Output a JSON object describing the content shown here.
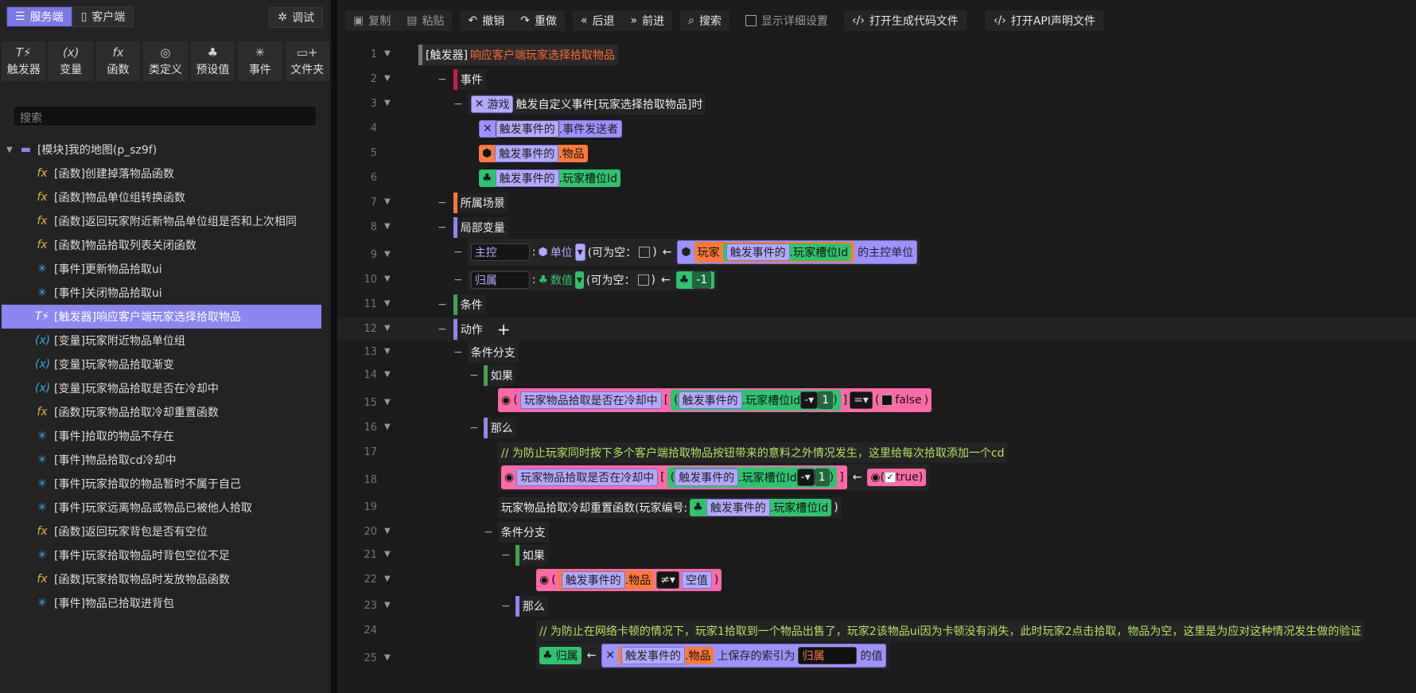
{
  "left_panel": {
    "modes": [
      "服务端",
      "客户端"
    ],
    "debug_label": "调试",
    "categories": [
      {
        "icon": "trigger",
        "label": "触发器"
      },
      {
        "icon": "variable",
        "label": "变量"
      },
      {
        "icon": "fx",
        "label": "函数"
      },
      {
        "icon": "class",
        "label": "类定义"
      },
      {
        "icon": "preset",
        "label": "预设值"
      },
      {
        "icon": "event",
        "label": "事件"
      },
      {
        "icon": "folder",
        "label": "文件夹"
      }
    ],
    "search_placeholder": "搜索",
    "tree_root": "[模块]我的地图(p_sz9f)",
    "tree_items": [
      {
        "type": "fx",
        "label": "[函数]创建掉落物品函数"
      },
      {
        "type": "fx",
        "label": "[函数]物品单位组转换函数"
      },
      {
        "type": "fx",
        "label": "[函数]返回玩家附近新物品单位组是否和上次相同"
      },
      {
        "type": "fx",
        "label": "[函数]物品拾取列表关闭函数"
      },
      {
        "type": "ev",
        "label": "[事件]更新物品拾取ui"
      },
      {
        "type": "ev",
        "label": "[事件]关闭物品拾取ui"
      },
      {
        "type": "tr",
        "label": "[触发器]响应客户端玩家选择拾取物品",
        "selected": true
      },
      {
        "type": "vr",
        "label": "[变量]玩家附近物品单位组"
      },
      {
        "type": "vr",
        "label": "[变量]玩家物品拾取渐变"
      },
      {
        "type": "vr",
        "label": "[变量]玩家物品拾取是否在冷却中"
      },
      {
        "type": "fx",
        "label": "[函数]玩家物品拾取冷却重置函数"
      },
      {
        "type": "ev",
        "label": "[事件]拾取的物品不存在"
      },
      {
        "type": "ev",
        "label": "[事件]物品拾取cd冷却中"
      },
      {
        "type": "ev",
        "label": "[事件]玩家拾取的物品暂时不属于自己"
      },
      {
        "type": "ev",
        "label": "[事件]玩家远离物品或物品已被他人拾取"
      },
      {
        "type": "fx",
        "label": "[函数]返回玩家背包是否有空位"
      },
      {
        "type": "ev",
        "label": "[事件]玩家拾取物品时背包空位不足"
      },
      {
        "type": "fx",
        "label": "[函数]玩家拾取物品时发放物品函数"
      },
      {
        "type": "ev",
        "label": "[事件]物品已拾取进背包"
      }
    ]
  },
  "toolbar": {
    "copy": "复制",
    "paste": "粘贴",
    "undo": "撤销",
    "redo": "重做",
    "back": "后退",
    "forward": "前进",
    "search": "搜索",
    "show_details": "显示详细设置",
    "open_gen": "打开生成代码文件",
    "open_api": "打开API声明文件"
  },
  "code": {
    "line_numbers": [
      "1",
      "2",
      "3",
      "4",
      "5",
      "6",
      "7",
      "8",
      "9",
      "10",
      "11",
      "12",
      "13",
      "14",
      "15",
      "16",
      "17",
      "18",
      "19",
      "20",
      "21",
      "22",
      "23",
      "24",
      "25"
    ],
    "l1_tag": "[触发器]",
    "l1_name": "响应客户端玩家选择拾取物品",
    "l2": "事件",
    "l3_game": "游戏",
    "l3_text": "触发自定义事件[玩家选择拾取物品]时",
    "l4_a": "触发事件的",
    "l4_b": ".事件发送者",
    "l5_a": "触发事件的",
    "l5_b": ".物品",
    "l6_a": "触发事件的",
    "l6_b": ".玩家槽位Id",
    "l7": "所属场景",
    "l8": "局部变量",
    "l9_var": "主控",
    "l9_type": "单位",
    "l9_null": "(可为空：",
    "l9_player": "玩家",
    "l9_ev": "触发事件的",
    "l9_slot": ".玩家槽位Id",
    "l9_tail": "的主控单位",
    "l10_var": "归属",
    "l10_type": "数值",
    "l10_null": "(可为空：",
    "l10_val": "-1",
    "l11": "条件",
    "l12": "动作",
    "l13": "条件分支",
    "l14": "如果",
    "l15_var": "玩家物品拾取是否在冷却中",
    "l15_ev": "触发事件的",
    "l15_slot": ".玩家槽位Id",
    "l15_op": "-",
    "l15_num": "1",
    "l15_eq": "=",
    "l15_val": "false",
    "l16": "那么",
    "l17": "// 为防止玩家同时按下多个客户端拾取物品按钮带来的意料之外情况发生，这里给每次拾取添加一个cd",
    "l18_var": "玩家物品拾取是否在冷却中",
    "l18_ev": "触发事件的",
    "l18_slot": ".玩家槽位Id",
    "l18_op": "-",
    "l18_num": "1",
    "l18_val": "true",
    "l19_fn": "玩家物品拾取冷却重置函数(玩家编号:",
    "l19_ev": "触发事件的",
    "l19_slot": ".玩家槽位Id",
    "l20": "条件分支",
    "l21": "如果",
    "l22_ev": "触发事件的",
    "l22_item": ".物品",
    "l22_op": "≠",
    "l22_val": "空值",
    "l23": "那么",
    "l24": "// 为防止在网络卡顿的情况下，玩家1拾取到一个物品出售了，玩家2该物品ui因为卡顿没有消失，此时玩家2点击拾取，物品为空，这里是为应对这种情况发生做的验证",
    "l25_var": "归属",
    "l25_ev": "触发事件的",
    "l25_item": ".物品",
    "l25_mid": "上保存的索引为",
    "l25_key": "归属",
    "l25_tail": "的值"
  },
  "colors": {
    "accent": "#8c87f0",
    "event": "#c8204a",
    "scene": "#ff7a3a",
    "local": "#8c87f0",
    "cond": "#8c87f0",
    "action": "#8c87f0",
    "if": "#3ea64a",
    "then": "#8c87f0"
  }
}
